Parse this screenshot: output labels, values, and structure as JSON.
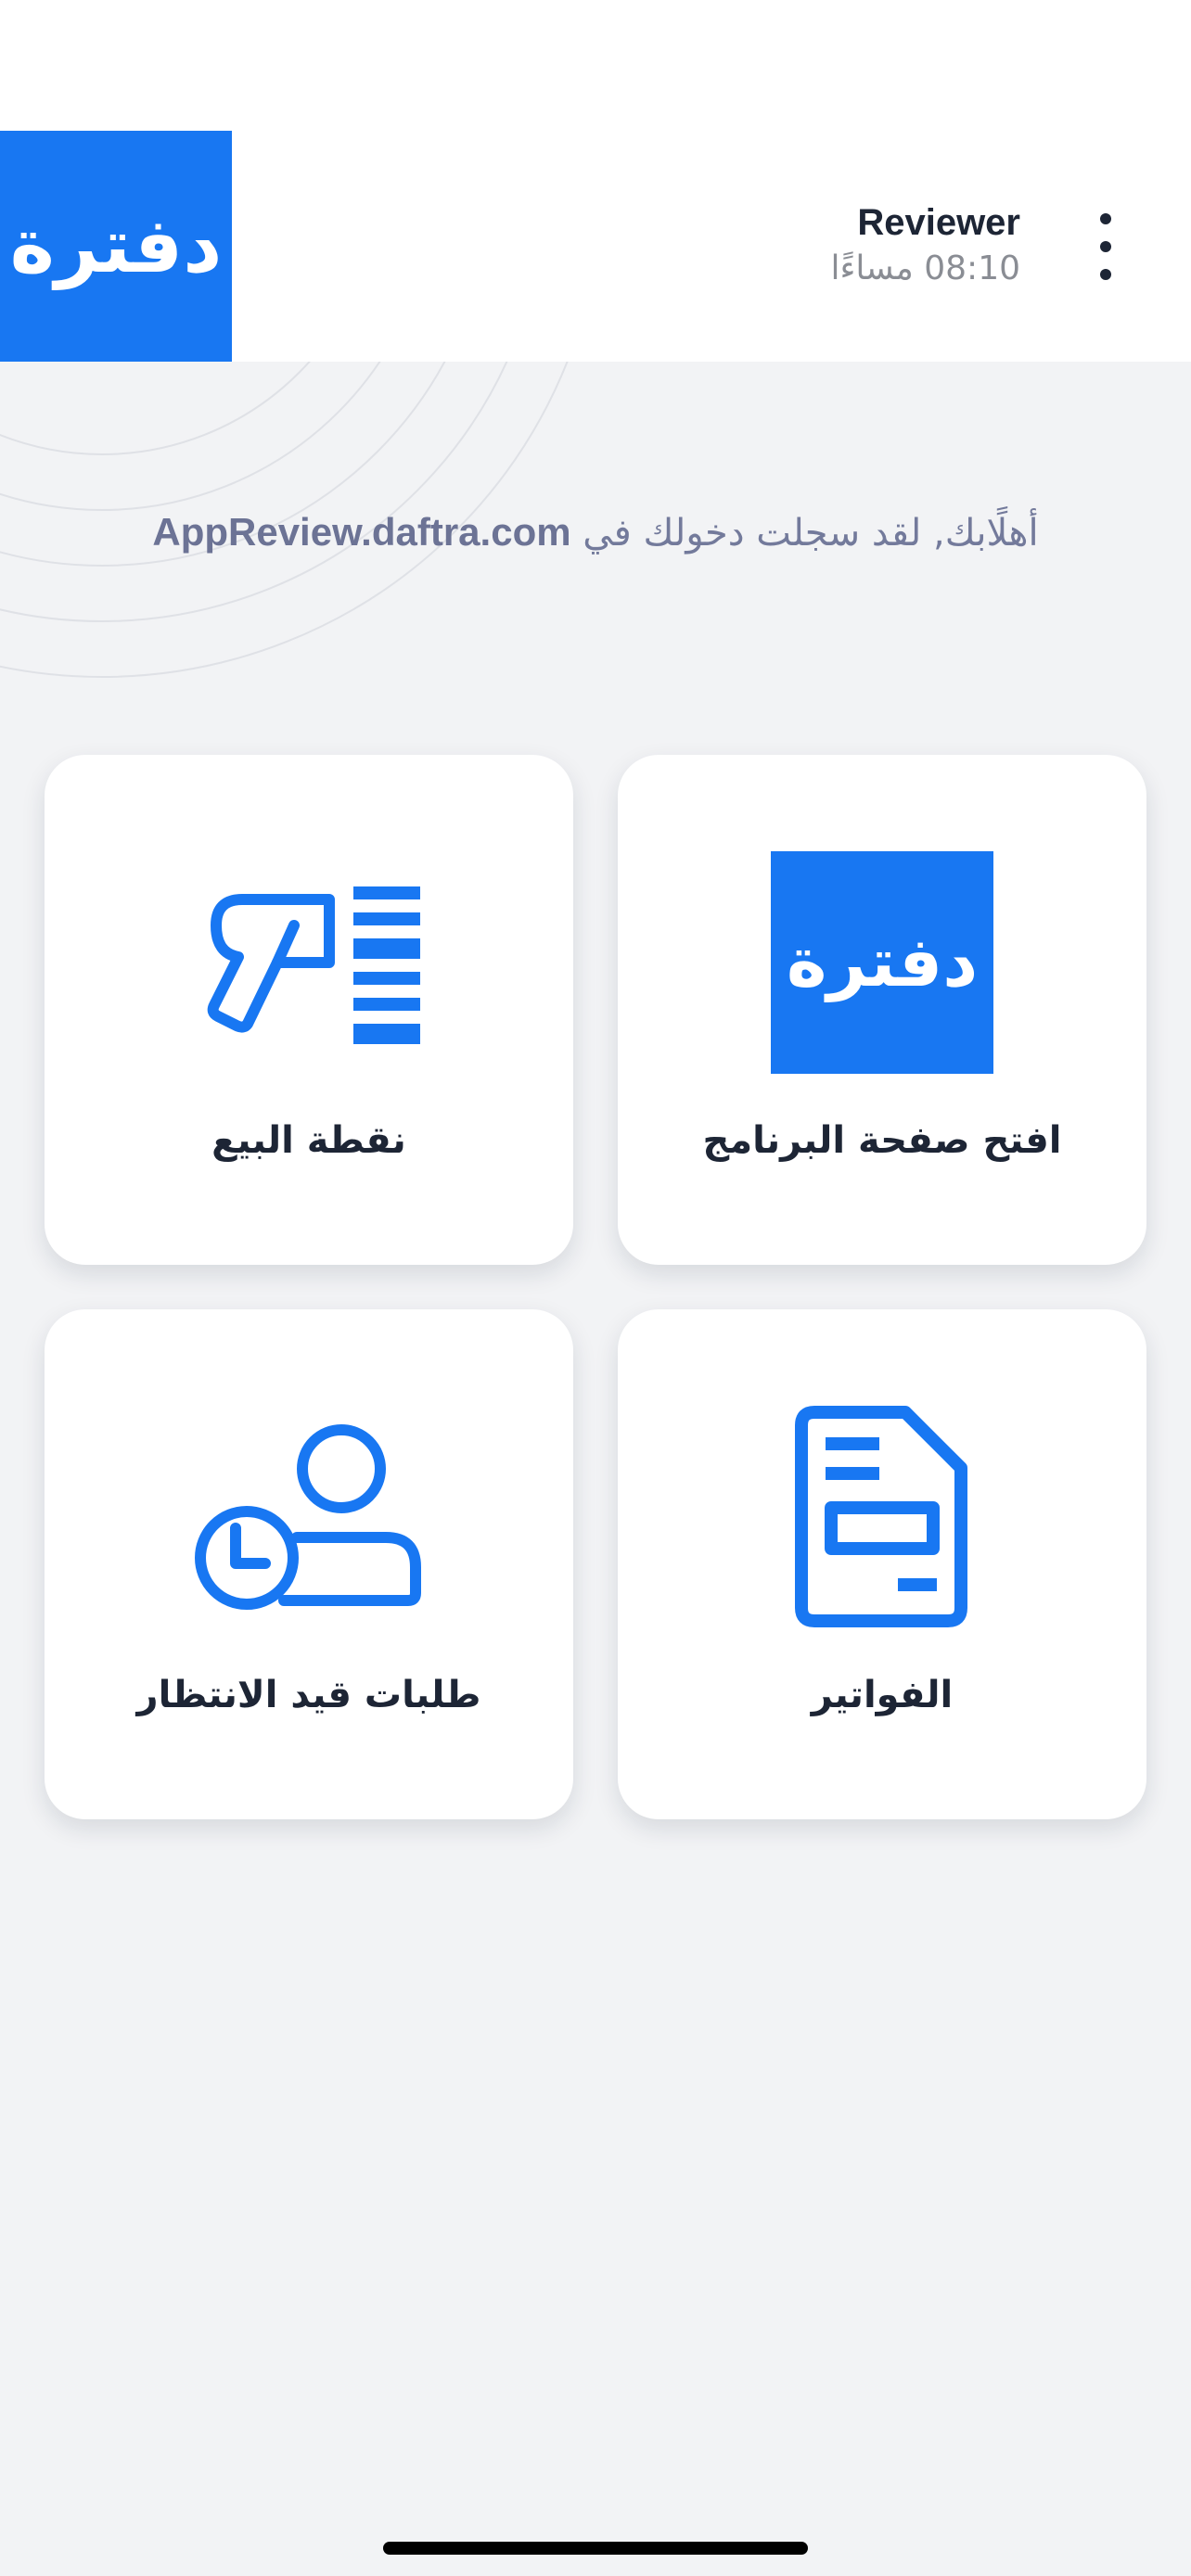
{
  "header": {
    "logo_text": "دفترة",
    "user_name": "Reviewer",
    "time": "08:10 مساءًا",
    "menu_icon": "more-vertical-icon"
  },
  "welcome": {
    "prefix": "أهلًابك, لقد سجلت دخولك في ",
    "domain": "AppReview.daftra.com"
  },
  "cards": {
    "open_app": {
      "label": "افتح صفحة البرنامج",
      "logo_text": "دفترة",
      "icon": "daftra-logo"
    },
    "pos": {
      "label": "نقطة البيع",
      "icon": "barcode-scanner-icon"
    },
    "invoices": {
      "label": "الفواتير",
      "icon": "invoice-document-icon"
    },
    "pending_orders": {
      "label": "طلبات قيد الانتظار",
      "icon": "user-clock-icon"
    }
  },
  "colors": {
    "brand_blue": "#1877f2",
    "text_dark": "#1d2535",
    "text_muted": "#8a8d94",
    "background": "#f2f3f5"
  }
}
